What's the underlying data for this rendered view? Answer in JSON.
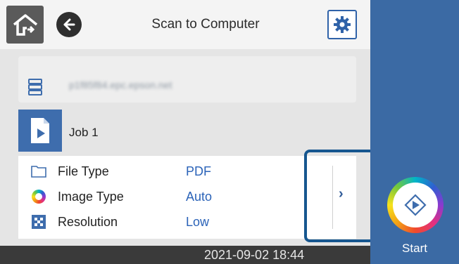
{
  "header": {
    "title": "Scan to Computer",
    "home_icon": "home-icon",
    "back_icon": "back-arrow-icon",
    "settings_icon": "gear-icon"
  },
  "computer": {
    "name": "p1f85f84.epc.epson.net",
    "icon": "server-icon"
  },
  "job": {
    "label": "Job 1",
    "icon": "document-icon"
  },
  "settings": [
    {
      "label": "File Type",
      "value": "PDF",
      "icon": "folder-icon"
    },
    {
      "label": "Image Type",
      "value": "Auto",
      "icon": "color-ring-icon"
    },
    {
      "label": "Resolution",
      "value": "Low",
      "icon": "resolution-icon"
    }
  ],
  "status": {
    "datetime": "2021-09-02 18:44"
  },
  "start": {
    "label": "Start"
  },
  "colors": {
    "accent": "#3b6aa4",
    "value_text": "#2b63b8",
    "highlight": "#16568f"
  }
}
